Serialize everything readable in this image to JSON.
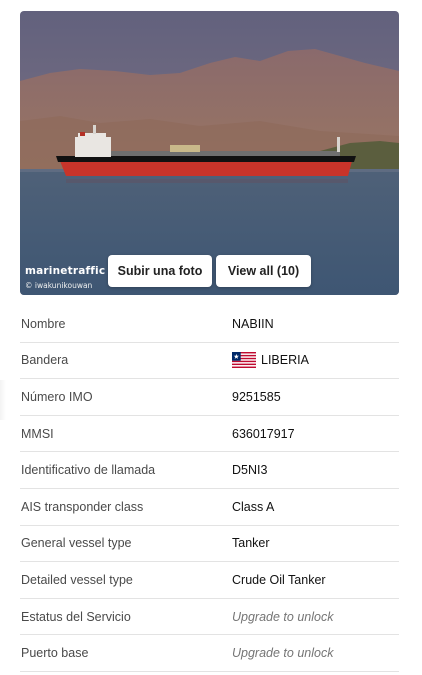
{
  "photo": {
    "watermark": "marinetraffic",
    "credit": "© iwakunikouwan"
  },
  "buttons": {
    "upload_label": "Subir una foto",
    "view_all_label": "View all (10)"
  },
  "details": [
    {
      "label": "Nombre",
      "value": "NABIIN"
    },
    {
      "label": "Bandera",
      "value": "LIBERIA",
      "icon": "liberia-flag-icon"
    },
    {
      "label": "Número IMO",
      "value": "9251585"
    },
    {
      "label": "MMSI",
      "value": "636017917"
    },
    {
      "label": "Identificativo de llamada",
      "value": "D5NI3"
    },
    {
      "label": "AIS transponder class",
      "value": "Class A"
    },
    {
      "label": "General vessel type",
      "value": "Tanker"
    },
    {
      "label": "Detailed vessel type",
      "value": "Crude Oil Tanker"
    },
    {
      "label": "Estatus del Servicio",
      "value": "Upgrade to unlock"
    },
    {
      "label": "Puerto base",
      "value": "Upgrade to unlock"
    }
  ]
}
